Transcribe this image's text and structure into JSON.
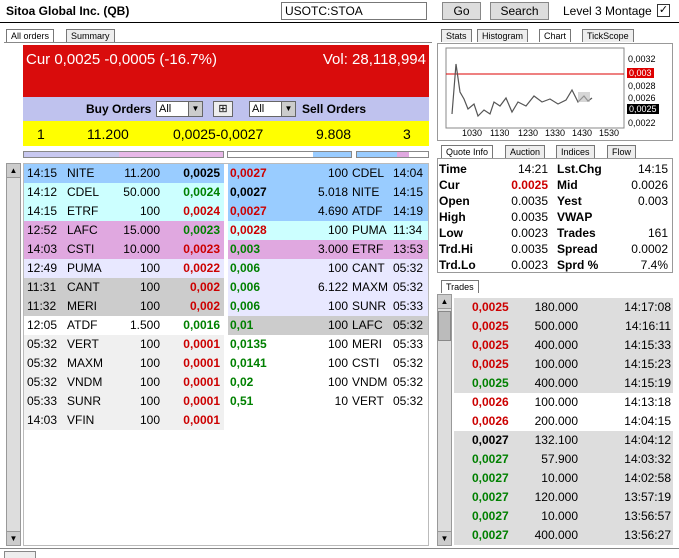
{
  "header": {
    "title": "Sitoa Global Inc. (QB)",
    "symbol": "USOTC:STOA",
    "go_label": "Go",
    "search_label": "Search",
    "level3_label": "Level 3 Montage",
    "level3_checked": "✓"
  },
  "left_tabs": [
    "All orders",
    "Summary"
  ],
  "price_bar": {
    "current": "Cur 0,0025 -0,0005 (-16.7%)",
    "volume": "Vol: 28,118,994",
    "color": "#d90c0c"
  },
  "orders_bar": {
    "buy_label": "Buy Orders",
    "buy_filter": "All",
    "sell_filter": "All",
    "sell_label": "Sell Orders"
  },
  "summary_bar": {
    "bid_count": "1",
    "bid_size": "11.200",
    "spread": "0,0025-0,0027",
    "ask_size": "9.808",
    "ask_count": "3"
  },
  "buy_orders": [
    {
      "time": "14:15",
      "mm": "NITE",
      "size": "11.200",
      "price": "0,0025",
      "bg": "#99ccff",
      "pc": "blk"
    },
    {
      "time": "14:12",
      "mm": "CDEL",
      "size": "50.000",
      "price": "0,0024",
      "bg": "#ccffff",
      "pc": "grn"
    },
    {
      "time": "14:15",
      "mm": "ETRF",
      "size": "100",
      "price": "0,0024",
      "bg": "#ccffff",
      "pc": "red"
    },
    {
      "time": "12:52",
      "mm": "LAFC",
      "size": "15.000",
      "price": "0,0023",
      "bg": "#e0a8e0",
      "pc": "grn"
    },
    {
      "time": "14:03",
      "mm": "CSTI",
      "size": "10.000",
      "price": "0,0023",
      "bg": "#e0a8e0",
      "pc": "red"
    },
    {
      "time": "12:49",
      "mm": "PUMA",
      "size": "100",
      "price": "0,0022",
      "bg": "#e8e8ff",
      "pc": "red"
    },
    {
      "time": "11:31",
      "mm": "CANT",
      "size": "100",
      "price": "0,002",
      "bg": "#cccccc",
      "pc": "red"
    },
    {
      "time": "11:32",
      "mm": "MERI",
      "size": "100",
      "price": "0,002",
      "bg": "#cccccc",
      "pc": "red"
    },
    {
      "time": "12:05",
      "mm": "ATDF",
      "size": "1.500",
      "price": "0,0016",
      "bg": "#ffffff",
      "pc": "grn"
    },
    {
      "time": "05:32",
      "mm": "VERT",
      "size": "100",
      "price": "0,0001",
      "bg": "#f0f0f0",
      "pc": "red"
    },
    {
      "time": "05:32",
      "mm": "MAXM",
      "size": "100",
      "price": "0,0001",
      "bg": "#f0f0f0",
      "pc": "red"
    },
    {
      "time": "05:32",
      "mm": "VNDM",
      "size": "100",
      "price": "0,0001",
      "bg": "#f0f0f0",
      "pc": "red"
    },
    {
      "time": "05:33",
      "mm": "SUNR",
      "size": "100",
      "price": "0,0001",
      "bg": "#f0f0f0",
      "pc": "red"
    },
    {
      "time": "14:03",
      "mm": "VFIN",
      "size": "100",
      "price": "0,0001",
      "bg": "#f0f0f0",
      "pc": "red"
    }
  ],
  "sell_orders": [
    {
      "price": "0,0027",
      "size": "100",
      "mm": "CDEL",
      "time": "14:04",
      "bg": "#99ccff",
      "pc": "red"
    },
    {
      "price": "0,0027",
      "size": "5.018",
      "mm": "NITE",
      "time": "14:15",
      "bg": "#99ccff",
      "pc": "blk"
    },
    {
      "price": "0,0027",
      "size": "4.690",
      "mm": "ATDF",
      "time": "14:19",
      "bg": "#99ccff",
      "pc": "red"
    },
    {
      "price": "0,0028",
      "size": "100",
      "mm": "PUMA",
      "time": "11:34",
      "bg": "#ccffff",
      "pc": "red"
    },
    {
      "price": "0,003",
      "size": "3.000",
      "mm": "ETRF",
      "time": "13:53",
      "bg": "#e0a8e0",
      "pc": "grn"
    },
    {
      "price": "0,006",
      "size": "100",
      "mm": "CANT",
      "time": "05:32",
      "bg": "#e8e8ff",
      "pc": "grn"
    },
    {
      "price": "0,006",
      "size": "6.122",
      "mm": "MAXM",
      "time": "05:32",
      "bg": "#e8e8ff",
      "pc": "grn"
    },
    {
      "price": "0,006",
      "size": "100",
      "mm": "SUNR",
      "time": "05:33",
      "bg": "#e8e8ff",
      "pc": "grn"
    },
    {
      "price": "0,01",
      "size": "100",
      "mm": "LAFC",
      "time": "05:32",
      "bg": "#cccccc",
      "pc": "grn"
    },
    {
      "price": "0,0135",
      "size": "100",
      "mm": "MERI",
      "time": "05:33",
      "bg": "#ffffff",
      "pc": "grn"
    },
    {
      "price": "0,0141",
      "size": "100",
      "mm": "CSTI",
      "time": "05:32",
      "bg": "#ffffff",
      "pc": "grn"
    },
    {
      "price": "0,02",
      "size": "100",
      "mm": "VNDM",
      "time": "05:32",
      "bg": "#ffffff",
      "pc": "grn"
    },
    {
      "price": "0,51",
      "size": "10",
      "mm": "VERT",
      "time": "05:32",
      "bg": "#ffffff",
      "pc": "grn"
    }
  ],
  "right_tabs_top": [
    "Stats",
    "Histogram",
    "Chart",
    "TickScope"
  ],
  "chart": {
    "x_ticks": [
      "1030",
      "1130",
      "1230",
      "1330",
      "1430",
      "1530"
    ],
    "y_ticks": [
      "0,0032",
      "0,003",
      "0,0028",
      "0,0026",
      "0,0025",
      "0,0022"
    ],
    "reference_price": "0,003",
    "current_price": "0,0025"
  },
  "right_tabs_mid": [
    "Quote Info",
    "Auction",
    "Indices",
    "Flow"
  ],
  "quote_info": [
    {
      "l1": "Time",
      "v1": "14:21",
      "l2": "Lst.Chg",
      "v2": "14:15"
    },
    {
      "l1": "Cur",
      "v1": "0.0025",
      "l2": "Mid",
      "v2": "0.0026"
    },
    {
      "l1": "Open",
      "v1": "0.0035",
      "l2": "Yest",
      "v2": "0.003"
    },
    {
      "l1": "High",
      "v1": "0.0035",
      "l2": "VWAP",
      "v2": ""
    },
    {
      "l1": "Low",
      "v1": "0.0023",
      "l2": "Trades",
      "v2": "161"
    },
    {
      "l1": "Trd.Hi",
      "v1": "0.0035",
      "l2": "Spread",
      "v2": "0.0002"
    },
    {
      "l1": "Trd.Lo",
      "v1": "0.0023",
      "l2": "Sprd %",
      "v2": "7.4%"
    }
  ],
  "trades_tab": "Trades",
  "trades": [
    {
      "price": "0,0025",
      "size": "180.000",
      "time": "14:17:08",
      "pc": "red",
      "bg": "#dddddd"
    },
    {
      "price": "0,0025",
      "size": "500.000",
      "time": "14:16:11",
      "pc": "red",
      "bg": "#dddddd"
    },
    {
      "price": "0,0025",
      "size": "400.000",
      "time": "14:15:33",
      "pc": "red",
      "bg": "#dddddd"
    },
    {
      "price": "0,0025",
      "size": "100.000",
      "time": "14:15:23",
      "pc": "red",
      "bg": "#dddddd"
    },
    {
      "price": "0,0025",
      "size": "400.000",
      "time": "14:15:19",
      "pc": "grn",
      "bg": "#dddddd"
    },
    {
      "price": "0,0026",
      "size": "100.000",
      "time": "14:13:18",
      "pc": "red",
      "bg": "#ffffff"
    },
    {
      "price": "0,0026",
      "size": "200.000",
      "time": "14:04:15",
      "pc": "red",
      "bg": "#ffffff"
    },
    {
      "price": "0,0027",
      "size": "132.100",
      "time": "14:04:12",
      "pc": "blk",
      "bg": "#dddddd"
    },
    {
      "price": "0,0027",
      "size": "57.900",
      "time": "14:03:32",
      "pc": "grn",
      "bg": "#dddddd"
    },
    {
      "price": "0,0027",
      "size": "10.000",
      "time": "14:02:58",
      "pc": "grn",
      "bg": "#dddddd"
    },
    {
      "price": "0,0027",
      "size": "120.000",
      "time": "13:57:19",
      "pc": "grn",
      "bg": "#dddddd"
    },
    {
      "price": "0,0027",
      "size": "10.000",
      "time": "13:56:57",
      "pc": "grn",
      "bg": "#dddddd"
    },
    {
      "price": "0,0027",
      "size": "400.000",
      "time": "13:56:27",
      "pc": "grn",
      "bg": "#dddddd"
    }
  ]
}
